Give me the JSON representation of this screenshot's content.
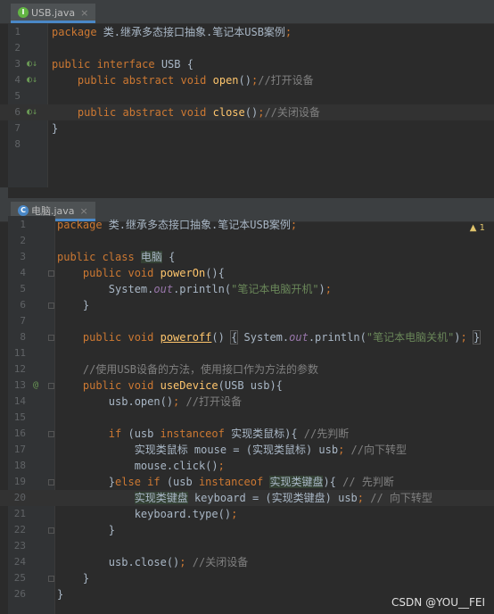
{
  "sidebar": {
    "letters": [
      "d",
      "d",
      "d",
      "d",
      "S",
      "S"
    ]
  },
  "usb_file": {
    "tab_label": "USB.java",
    "tab_icon": "I",
    "lines": [
      {
        "n": "1",
        "tokens": [
          [
            "kw",
            "package "
          ],
          [
            "txt",
            "类.继承多态接口抽象.笔记本USB案例"
          ],
          [
            "kw",
            ";"
          ]
        ]
      },
      {
        "n": "2",
        "tokens": []
      },
      {
        "n": "3",
        "tokens": [
          [
            "kw",
            "public interface "
          ],
          [
            "txt",
            "USB {"
          ]
        ]
      },
      {
        "n": "4",
        "tokens": [
          [
            "txt",
            "    "
          ],
          [
            "kw",
            "public abstract void "
          ],
          [
            "fn",
            "open"
          ],
          [
            "txt",
            "()"
          ],
          [
            "kw",
            ";"
          ],
          [
            "cmt",
            "//打开设备"
          ]
        ]
      },
      {
        "n": "5",
        "tokens": []
      },
      {
        "n": "6",
        "tokens": [
          [
            "txt",
            "    "
          ],
          [
            "kw",
            "public abstract void "
          ],
          [
            "fn",
            "close"
          ],
          [
            "txt",
            "()"
          ],
          [
            "kw",
            ";"
          ],
          [
            "cmt",
            "//关闭设备"
          ]
        ]
      },
      {
        "n": "7",
        "tokens": [
          [
            "txt",
            "}"
          ]
        ]
      },
      {
        "n": "8",
        "tokens": []
      }
    ]
  },
  "pc_file": {
    "tab_label": "电脑.java",
    "tab_icon": "C",
    "warning_count": "▲ 1",
    "lines": [
      {
        "n": "1",
        "tokens": [
          [
            "kw",
            "package "
          ],
          [
            "txt",
            "类.继承多态接口抽象.笔记本USB案例"
          ],
          [
            "kw",
            ";"
          ]
        ]
      },
      {
        "n": "2",
        "tokens": []
      },
      {
        "n": "3",
        "tokens": [
          [
            "kw",
            "public class "
          ],
          [
            "hl",
            "电脑"
          ],
          [
            "txt",
            " {"
          ]
        ]
      },
      {
        "n": "4",
        "tokens": [
          [
            "txt",
            "    "
          ],
          [
            "kw",
            "public void "
          ],
          [
            "fn",
            "powerOn"
          ],
          [
            "txt",
            "(){"
          ]
        ]
      },
      {
        "n": "5",
        "tokens": [
          [
            "txt",
            "        System."
          ],
          [
            "it",
            "out"
          ],
          [
            "txt",
            ".println("
          ],
          [
            "str",
            "\"笔记本电脑开机\""
          ],
          [
            "txt",
            ")"
          ],
          [
            "kw",
            ";"
          ]
        ]
      },
      {
        "n": "6",
        "tokens": [
          [
            "txt",
            "    }"
          ]
        ]
      },
      {
        "n": "7",
        "tokens": []
      },
      {
        "n": "8",
        "tokens": [
          [
            "txt",
            "    "
          ],
          [
            "kw",
            "public void "
          ],
          [
            "fnu",
            "poweroff"
          ],
          [
            "txt",
            "() "
          ],
          [
            "box",
            "{"
          ],
          [
            "txt",
            " System."
          ],
          [
            "it",
            "out"
          ],
          [
            "txt",
            ".println("
          ],
          [
            "str",
            "\"笔记本电脑关机\""
          ],
          [
            "txt",
            ")"
          ],
          [
            "kw",
            ";"
          ],
          [
            "txt",
            " "
          ],
          [
            "box",
            "}"
          ]
        ]
      },
      {
        "n": "11",
        "tokens": []
      },
      {
        "n": "12",
        "tokens": [
          [
            "txt",
            "    "
          ],
          [
            "cmt",
            "//使用USB设备的方法，使用接口作为方法的参数"
          ]
        ]
      },
      {
        "n": "13",
        "tokens": [
          [
            "txt",
            "    "
          ],
          [
            "kw",
            "public void "
          ],
          [
            "fn",
            "useDevice"
          ],
          [
            "txt",
            "(USB usb){"
          ]
        ]
      },
      {
        "n": "14",
        "tokens": [
          [
            "txt",
            "        usb.open()"
          ],
          [
            "kw",
            ";"
          ],
          [
            "cmt",
            " //打开设备"
          ]
        ]
      },
      {
        "n": "15",
        "tokens": []
      },
      {
        "n": "16",
        "tokens": [
          [
            "txt",
            "        "
          ],
          [
            "kw",
            "if "
          ],
          [
            "txt",
            "(usb "
          ],
          [
            "kw",
            "instanceof "
          ],
          [
            "txt",
            "实现类鼠标){ "
          ],
          [
            "cmt",
            "//先判断"
          ]
        ]
      },
      {
        "n": "17",
        "tokens": [
          [
            "txt",
            "            实现类鼠标 mouse = (实现类鼠标) usb"
          ],
          [
            "kw",
            ";"
          ],
          [
            "cmt",
            " //向下转型"
          ]
        ]
      },
      {
        "n": "18",
        "tokens": [
          [
            "txt",
            "            mouse.click()"
          ],
          [
            "kw",
            ";"
          ]
        ]
      },
      {
        "n": "19",
        "tokens": [
          [
            "txt",
            "        }"
          ],
          [
            "kw",
            "else if "
          ],
          [
            "txt",
            "(usb "
          ],
          [
            "kw",
            "instanceof "
          ],
          [
            "hl",
            "实现类键盘"
          ],
          [
            "txt",
            "){ "
          ],
          [
            "cmt",
            "// 先判断"
          ]
        ]
      },
      {
        "n": "20",
        "tokens": [
          [
            "txt",
            "            "
          ],
          [
            "hl",
            "实现类键盘"
          ],
          [
            "txt",
            " keyboard = (实现类键盘) usb"
          ],
          [
            "kw",
            ";"
          ],
          [
            "cmt",
            " // 向下转型"
          ]
        ]
      },
      {
        "n": "21",
        "tokens": [
          [
            "txt",
            "            keyboard.type()"
          ],
          [
            "kw",
            ";"
          ]
        ]
      },
      {
        "n": "22",
        "tokens": [
          [
            "txt",
            "        }"
          ]
        ]
      },
      {
        "n": "23",
        "tokens": []
      },
      {
        "n": "24",
        "tokens": [
          [
            "txt",
            "        usb.close()"
          ],
          [
            "kw",
            ";"
          ],
          [
            "cmt",
            " //关闭设备"
          ]
        ]
      },
      {
        "n": "25",
        "tokens": [
          [
            "txt",
            "    }"
          ]
        ]
      },
      {
        "n": "26",
        "tokens": [
          [
            "txt",
            "}"
          ]
        ]
      }
    ]
  },
  "watermark": "CSDN @YOU__FEI"
}
